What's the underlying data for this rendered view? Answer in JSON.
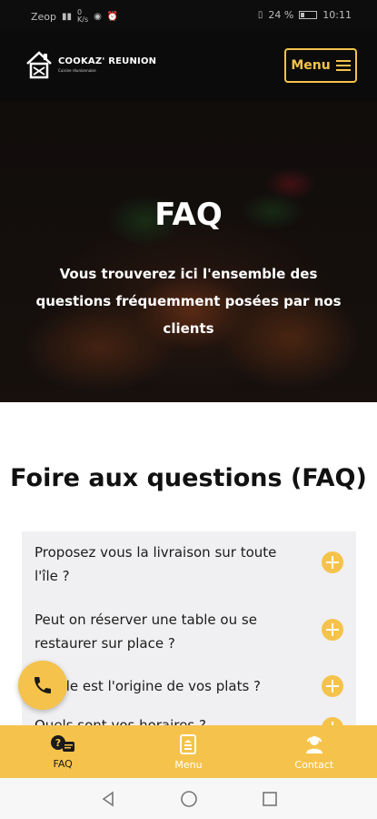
{
  "status_bar": {
    "carrier": "Zeop",
    "net_speed_value": "0",
    "net_speed_unit": "K/s",
    "battery_percent": "24 %",
    "time": "10:11"
  },
  "header": {
    "logo_name": "COOKAZ' REUNION",
    "logo_tagline": "Cuisine réunionnaise",
    "menu_label": "Menu"
  },
  "hero": {
    "title": "FAQ",
    "subtitle": "Vous trouverez ici l'ensemble des questions fréquemment posées par nos clients"
  },
  "section": {
    "title": "Foire aux questions (FAQ)"
  },
  "faq": [
    {
      "question": "Proposez vous la livraison sur toute l'île ?"
    },
    {
      "question": "Peut on réserver une table ou se restaurer sur place ?"
    },
    {
      "question": "Quelle est l'origine de vos plats ?"
    },
    {
      "question": "Quels sont vos horaires ?"
    }
  ],
  "bottom_nav": [
    {
      "label": "FAQ",
      "icon": "faq-icon",
      "active": true
    },
    {
      "label": "Menu",
      "icon": "menu-book-icon",
      "active": false
    },
    {
      "label": "Contact",
      "icon": "contact-icon",
      "active": false
    }
  ],
  "colors": {
    "accent": "#f5c34b",
    "header_bg": "#0b0b0b",
    "faq_bg": "#f0f0f2"
  }
}
